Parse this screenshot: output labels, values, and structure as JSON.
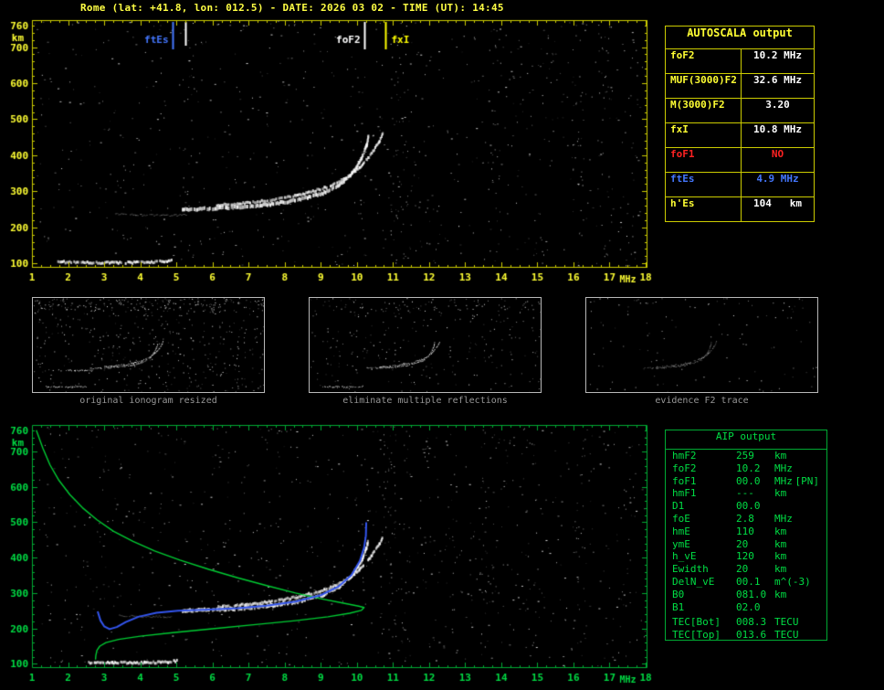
{
  "title": "Rome (lat: +41.8, lon: 012.5) - DATE: 2026 03 02 - TIME (UT): 14:45",
  "colors": {
    "background": "#000000",
    "yellow_text": "#ffff33",
    "yellow_border": "#cccc00",
    "green_text": "#00dd44",
    "green_border": "#00aa33",
    "blue": "#4477ff",
    "red": "#ff2222",
    "white": "#ffffff",
    "caption_gray": "#979797"
  },
  "autoscala": {
    "title": "AUTOSCALA output",
    "rows": [
      {
        "label": "foF2",
        "value": "10.2 MHz",
        "label_color": "#ffff33",
        "value_color": "#ffffff"
      },
      {
        "label": "MUF(3000)F2",
        "value": "32.6 MHz",
        "label_color": "#ffff33",
        "value_color": "#ffffff"
      },
      {
        "label": "M(3000)F2",
        "value": "3.20",
        "label_color": "#ffff33",
        "value_color": "#ffffff"
      },
      {
        "label": "fxI",
        "value": "10.8 MHz",
        "label_color": "#ffff33",
        "value_color": "#ffffff"
      },
      {
        "label": "foF1",
        "value": "NO",
        "label_color": "#ff2222",
        "value_color": "#ff2222"
      },
      {
        "label": "ftEs",
        "value": "4.9 MHz",
        "label_color": "#4477ff",
        "value_color": "#4477ff"
      },
      {
        "label": "h'Es",
        "value": "104   km",
        "label_color": "#ffff33",
        "value_color": "#ffffff"
      }
    ]
  },
  "thumbnails": [
    {
      "caption": "original ionogram resized",
      "noise": 430,
      "top_noise": 170,
      "series": [
        0,
        1,
        2,
        3
      ],
      "alpha": 0.9
    },
    {
      "caption": "eliminate multiple reflections",
      "noise": 260,
      "top_noise": 60,
      "series": [
        0,
        2,
        3
      ],
      "alpha": 0.9
    },
    {
      "caption": "evidence F2 trace",
      "noise": 95,
      "top_noise": 25,
      "series": [
        2,
        3
      ],
      "alpha": 0.55
    }
  ],
  "aip": {
    "title": "AIP output",
    "rows": [
      {
        "name": "hmF2",
        "value": "259",
        "unit": "km"
      },
      {
        "name": "foF2",
        "value": "10.2",
        "unit": "MHz"
      },
      {
        "name": "foF1",
        "value": "00.0",
        "unit": "MHz",
        "note": "[PN]"
      },
      {
        "name": "hmF1",
        "value": "---",
        "unit": "km"
      },
      {
        "name": "D1",
        "value": "00.0",
        "unit": ""
      },
      {
        "name": "foE",
        "value": "2.8",
        "unit": "MHz"
      },
      {
        "name": "hmE",
        "value": "110",
        "unit": "km"
      },
      {
        "name": "ymE",
        "value": "20",
        "unit": "km"
      },
      {
        "name": "h_vE",
        "value": "120",
        "unit": "km"
      },
      {
        "name": "Ewidth",
        "value": "20",
        "unit": "km"
      },
      {
        "name": "DelN_vE",
        "value": "00.1",
        "unit": "m^(-3)"
      },
      {
        "name": "B0",
        "value": "081.0",
        "unit": "km"
      },
      {
        "name": "B1",
        "value": "02.0",
        "unit": ""
      },
      {
        "name": "TEC[Bot]",
        "value": "008.3",
        "unit": "TECU",
        "gap": true
      },
      {
        "name": "TEC[Top]",
        "value": "013.6",
        "unit": "TECU"
      }
    ]
  },
  "chart_data": [
    {
      "id": "main_ionogram",
      "type": "scatter",
      "title": "ionogram with AUTOSCALA scaling markers",
      "xlabel": "MHz",
      "ylabel": "km",
      "axis_color": "#cccc00",
      "label_color": "#ffff33",
      "xlim": [
        1,
        18.05
      ],
      "ylim": [
        88,
        775
      ],
      "x_ticks": [
        1,
        2,
        3,
        4,
        5,
        6,
        7,
        8,
        9,
        10,
        11,
        12,
        13,
        14,
        15,
        16,
        17,
        18
      ],
      "y_ticks": [
        760,
        700,
        600,
        500,
        400,
        300,
        200,
        100
      ],
      "grid": false,
      "legend": "none",
      "markers": [
        {
          "label": "ftEs",
          "x": 4.9,
          "color": "#4477ff",
          "side": "left",
          "len": 30
        },
        {
          "label": "",
          "x": 5.25,
          "color": "#ffffff",
          "side": "left",
          "len": 26
        },
        {
          "label": "foF2",
          "x": 10.2,
          "color": "#ffffff",
          "side": "left",
          "len": 30
        },
        {
          "label": "fxI",
          "x": 10.8,
          "color": "#ffff00",
          "side": "right",
          "len": 30
        }
      ],
      "series": [
        {
          "name": "E trace (h'Es 104 km)",
          "color": "#ffffff",
          "width": 3,
          "alpha": 0.95,
          "points": [
            [
              1.7,
              104
            ],
            [
              2.6,
              102
            ],
            [
              3.6,
              102
            ],
            [
              4.4,
              104
            ],
            [
              4.85,
              108
            ]
          ]
        },
        {
          "name": "Es faint second reflection",
          "color": "#bbbbbb",
          "width": 1,
          "alpha": 0.4,
          "points": [
            [
              3.3,
              237
            ],
            [
              4.0,
              234
            ],
            [
              4.8,
              233
            ],
            [
              5.3,
              235
            ]
          ]
        },
        {
          "name": "F2 ordinary trace (foF2 10.2 MHz)",
          "color": "#ffffff",
          "width": 4,
          "alpha": 0.95,
          "points": [
            [
              5.15,
              250
            ],
            [
              5.9,
              252
            ],
            [
              6.7,
              256
            ],
            [
              7.5,
              263
            ],
            [
              8.3,
              275
            ],
            [
              9.0,
              293
            ],
            [
              9.5,
              318
            ],
            [
              9.85,
              350
            ],
            [
              10.1,
              390
            ],
            [
              10.25,
              428
            ],
            [
              10.3,
              455
            ]
          ]
        },
        {
          "name": "F2 extraordinary trace (fxI 10.8 MHz)",
          "color": "#ffffff",
          "width": 3,
          "alpha": 0.9,
          "points": [
            [
              6.1,
              261
            ],
            [
              6.9,
              267
            ],
            [
              7.7,
              277
            ],
            [
              8.45,
              291
            ],
            [
              9.1,
              310
            ],
            [
              9.65,
              335
            ],
            [
              10.05,
              365
            ],
            [
              10.35,
              400
            ],
            [
              10.6,
              438
            ],
            [
              10.7,
              462
            ]
          ]
        }
      ],
      "noise": {
        "count": 720,
        "stripes": [
          {
            "x": 5.3,
            "count": 18
          },
          {
            "x": 11.1,
            "count": 42
          },
          {
            "x": 11.45,
            "count": 22
          },
          {
            "x": 13.8,
            "count": 26
          },
          {
            "x": 15.2,
            "count": 18
          },
          {
            "x": 16.1,
            "count": 34
          },
          {
            "x": 16.9,
            "count": 24
          },
          {
            "x": 17.6,
            "count": 18
          }
        ]
      }
    },
    {
      "id": "profile_ionogram",
      "type": "scatter",
      "title": "ionogram with fitted trace and electron density profile",
      "xlabel": "MHz",
      "ylabel": "km",
      "axis_color": "#00aa33",
      "label_color": "#00dd44",
      "xlim": [
        1,
        18.05
      ],
      "ylim": [
        88,
        775
      ],
      "x_ticks": [
        1,
        2,
        3,
        4,
        5,
        6,
        7,
        8,
        9,
        10,
        11,
        12,
        13,
        14,
        15,
        16,
        17,
        18
      ],
      "y_ticks": [
        760,
        700,
        600,
        500,
        400,
        300,
        200,
        100
      ],
      "grid": false,
      "legend": "none",
      "markers": [],
      "series": [
        {
          "name": "E trace",
          "color": "#ffffff",
          "width": 3,
          "alpha": 0.95,
          "points": [
            [
              2.55,
              104
            ],
            [
              3.2,
              103
            ],
            [
              4.1,
              103
            ],
            [
              4.75,
              105
            ],
            [
              5.0,
              108
            ]
          ]
        },
        {
          "name": "faint mid trace",
          "color": "#bbbbbb",
          "width": 1,
          "alpha": 0.4,
          "points": [
            [
              3.4,
              236
            ],
            [
              4.1,
              233
            ],
            [
              4.9,
              233
            ]
          ]
        },
        {
          "name": "F2 ordinary trace",
          "color": "#ffffff",
          "width": 4,
          "alpha": 0.95,
          "points": [
            [
              5.15,
              250
            ],
            [
              5.9,
              252
            ],
            [
              6.7,
              256
            ],
            [
              7.5,
              263
            ],
            [
              8.3,
              275
            ],
            [
              9.0,
              293
            ],
            [
              9.5,
              318
            ],
            [
              9.85,
              350
            ],
            [
              10.1,
              390
            ],
            [
              10.25,
              428
            ],
            [
              10.3,
              455
            ]
          ]
        },
        {
          "name": "F2 extraordinary trace",
          "color": "#ffffff",
          "width": 3,
          "alpha": 0.9,
          "points": [
            [
              6.1,
              261
            ],
            [
              6.9,
              267
            ],
            [
              7.7,
              277
            ],
            [
              8.45,
              291
            ],
            [
              9.1,
              310
            ],
            [
              9.65,
              335
            ],
            [
              10.05,
              365
            ],
            [
              10.35,
              400
            ],
            [
              10.6,
              438
            ],
            [
              10.7,
              462
            ]
          ]
        }
      ],
      "curves": [
        {
          "name": "electron density profile (hmF2 259 km, foE 2.8 MHz, hmE 110 km)",
          "color": "#00cc33",
          "width": 1.4,
          "points": [
            [
              1.12,
              760
            ],
            [
              1.3,
              710
            ],
            [
              1.5,
              662
            ],
            [
              1.75,
              618
            ],
            [
              2.05,
              578
            ],
            [
              2.4,
              541
            ],
            [
              2.8,
              507
            ],
            [
              3.25,
              475
            ],
            [
              3.8,
              446
            ],
            [
              4.4,
              419
            ],
            [
              5.1,
              393
            ],
            [
              5.9,
              367
            ],
            [
              6.7,
              343
            ],
            [
              7.5,
              321
            ],
            [
              8.3,
              300
            ],
            [
              9.0,
              284
            ],
            [
              9.6,
              272
            ],
            [
              10.05,
              263
            ],
            [
              10.2,
              259
            ],
            [
              10.12,
              251
            ],
            [
              9.8,
              243
            ],
            [
              9.2,
              233
            ],
            [
              8.3,
              222
            ],
            [
              7.2,
              211
            ],
            [
              6.0,
              199
            ],
            [
              4.9,
              188
            ],
            [
              4.0,
              178
            ],
            [
              3.4,
              169
            ],
            [
              3.05,
              160
            ],
            [
              2.88,
              150
            ],
            [
              2.8,
              138
            ],
            [
              2.77,
              124
            ],
            [
              2.76,
              112
            ]
          ]
        },
        {
          "name": "AUTOSCALA fitted trace",
          "color": "#3355ee",
          "width": 2,
          "points": [
            [
              2.82,
              248
            ],
            [
              2.9,
              222
            ],
            [
              3.0,
              206
            ],
            [
              3.15,
              198
            ],
            [
              3.35,
              204
            ],
            [
              3.6,
              218
            ],
            [
              3.95,
              233
            ],
            [
              4.45,
              244
            ],
            [
              5.05,
              250
            ],
            [
              5.9,
              253
            ],
            [
              6.7,
              257
            ],
            [
              7.5,
              264
            ],
            [
              8.3,
              276
            ],
            [
              9.0,
              294
            ],
            [
              9.5,
              319
            ],
            [
              9.85,
              351
            ],
            [
              10.08,
              390
            ],
            [
              10.2,
              428
            ],
            [
              10.25,
              462
            ],
            [
              10.26,
              500
            ]
          ]
        }
      ],
      "noise": {
        "count": 780,
        "stripes": [
          {
            "x": 6.3,
            "count": 14
          },
          {
            "x": 10.9,
            "count": 40
          },
          {
            "x": 11.3,
            "count": 26
          },
          {
            "x": 12.6,
            "count": 18
          },
          {
            "x": 13.6,
            "count": 28
          },
          {
            "x": 14.8,
            "count": 18
          },
          {
            "x": 16.2,
            "count": 26
          },
          {
            "x": 17.4,
            "count": 20
          }
        ]
      }
    }
  ]
}
